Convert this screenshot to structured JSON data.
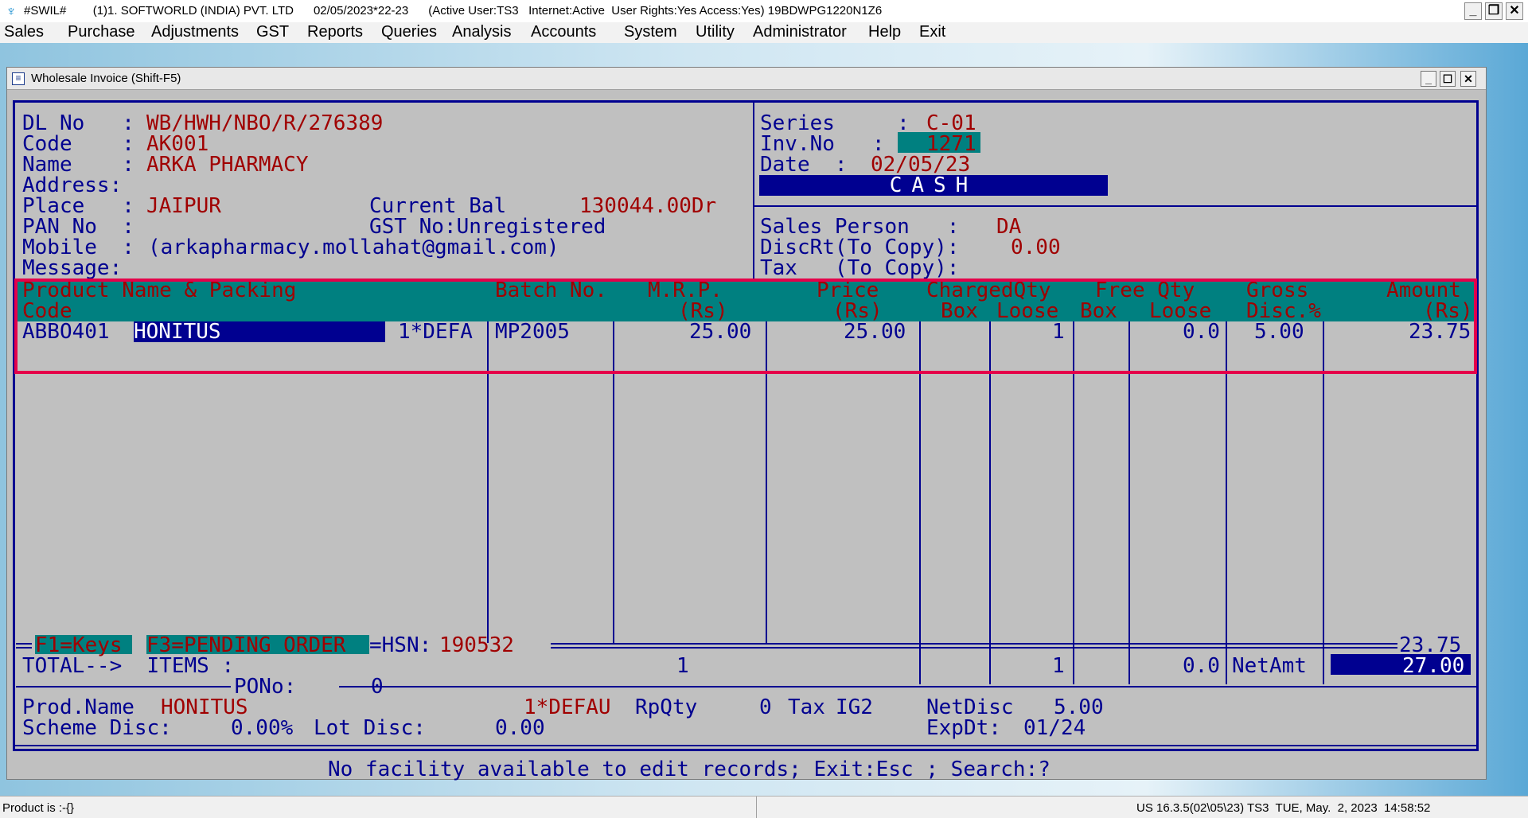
{
  "titlebar": {
    "text": "#SWIL#        (1)1. SOFTWORLD (INDIA) PVT. LTD      02/05/2023*22-23      (Active User:TS3   Internet:Active  User Rights:Yes Access:Yes) 19BDWPG1220N1Z6",
    "app_icon": "swil-app-icon",
    "minimize": "_",
    "restore": "❐",
    "close": "✕"
  },
  "menubar": [
    {
      "label": "Sales"
    },
    {
      "label": "Purchase"
    },
    {
      "label": "Adjustments"
    },
    {
      "label": "GST"
    },
    {
      "label": "Reports"
    },
    {
      "label": "Queries"
    },
    {
      "label": "Analysis"
    },
    {
      "label": "Accounts"
    },
    {
      "label": "System"
    },
    {
      "label": "Utility"
    },
    {
      "label": "Administrator"
    },
    {
      "label": "Help"
    },
    {
      "label": "Exit"
    }
  ],
  "window": {
    "title": "Wholesale Invoice (Shift-F5)",
    "minimize": "_",
    "restore": "☐",
    "close": "✕"
  },
  "party": {
    "dl_label": "DL No   :",
    "dl_value": "WB/HWH/NBO/R/276389",
    "code_label": "Code    :",
    "code_value": "AK001",
    "name_label": "Name    :",
    "name_value": "ARKA PHARMACY",
    "address_label": "Address:",
    "place_label": "Place   :",
    "place_value": "JAIPUR",
    "curbal_label": "Current Bal",
    "curbal_value": "130044.00Dr",
    "pan_label": "PAN No  :",
    "gst_label": "GST No:Unregistered",
    "mobile_label": "Mobile  :",
    "mobile_value": "(arkapharmacy.mollahat@gmail.com)",
    "message_label": "Message:"
  },
  "invoice": {
    "series_label": "Series     :",
    "series_value": "C-01",
    "invno_label": "Inv.No   :",
    "invno_value": "1271",
    "date_label": "Date  :",
    "date_value": "02/05/23",
    "mode": "CASH",
    "salesperson_label": "Sales Person   :",
    "salesperson_value": "DA",
    "discrt_label": "DiscRt(To Copy):",
    "discrt_value": "0.00",
    "tax_label": "Tax   (To Copy):"
  },
  "grid": {
    "headers_row1": [
      "Product Name & Packing",
      "Batch No.",
      "M.R.P.",
      "Price",
      "ChargedQty",
      "Free Qty",
      "Gross",
      "Amount"
    ],
    "headers_row2": [
      "Code",
      "(Rs)",
      "(Rs)",
      "Box",
      "Loose",
      "Box",
      "Loose",
      "Disc.%",
      "(Rs)"
    ],
    "rows": [
      {
        "code": "ABBO401",
        "name": "HONITUS",
        "packing": "1*DEFA",
        "batch": "MP2005",
        "mrp": "25.00",
        "price": "25.00",
        "charged_box": "",
        "charged_loose": "1",
        "free_box": "",
        "free_loose": "0.0",
        "disc": "5.00",
        "amount": "23.75"
      }
    ]
  },
  "footer": {
    "f1": "F1=Keys",
    "f3": "F3=PENDING ORDER",
    "hsn_label": "=HSN:",
    "hsn_value": "190532",
    "subtotal": "23.75",
    "total_label": "TOTAL-->  ITEMS :",
    "total_items": "1",
    "total_loose": "1",
    "total_free_loose": "0.0",
    "netamt_label": "NetAmt",
    "netamt_value": "27.00",
    "pono_label": "PONo:",
    "pono_value": "0",
    "prodname_label": "Prod.Name",
    "prodname_value": "HONITUS",
    "packing_value": "1*DEFAU",
    "rpqty_label": "RpQty",
    "rpqty_value": "0",
    "tax_label": "Tax",
    "tax_value": "IG2",
    "netdisc_label": "NetDisc",
    "netdisc_value": "5.00",
    "scheme_label": "Scheme Disc:",
    "scheme_value": "0.00%",
    "lot_label": "Lot Disc:",
    "lot_value": "0.00",
    "expdt_label": "ExpDt:",
    "expdt_value": "01/24",
    "message": "No facility available to edit records; Exit:Esc ; Search:?"
  },
  "statusbar": {
    "left": "Product is :-{}",
    "right": "US 16.3.5(02\\05\\23) TS3  TUE, May.  2, 2023  14:58:52"
  }
}
